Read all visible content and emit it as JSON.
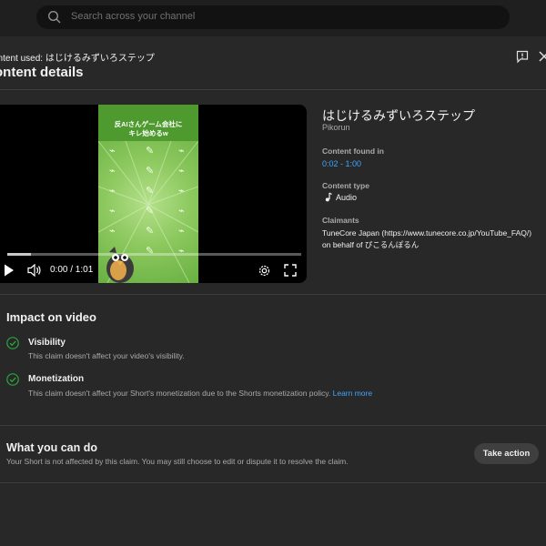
{
  "search": {
    "placeholder": "Search across your channel"
  },
  "dialog": {
    "content_used": "ontent used: はじけるみずいろステップ",
    "title": "ontent details"
  },
  "thumbnail": {
    "line1": "反AIさんゲーム会社に",
    "line2": "キレ始めるw"
  },
  "player": {
    "time": "0:00 / 1:01",
    "progress": 0.08
  },
  "details": {
    "song_title": "はじけるみずいろステップ",
    "artist": "Pikorun",
    "content_found_label": "Content found in",
    "content_found_value": "0:02 - 1:00",
    "content_type_label": "Content type",
    "content_type_value": "Audio",
    "claimants_label": "Claimants",
    "claimant_line1": "TuneCore Japan (https://www.tunecore.co.jp/YouTube_FAQ/)",
    "claimant_line2": "on behalf of ぴこるんぽるん"
  },
  "impact": {
    "title": "Impact on video",
    "visibility_title": "Visibility",
    "visibility_desc": "This claim doesn't affect your video's visibility.",
    "monetization_title": "Monetization",
    "monetization_desc": "This claim doesn't affect your Short's monetization due to the Shorts monetization policy.",
    "learn_more": "Learn more"
  },
  "actions": {
    "title": "What you can do",
    "desc": "Your Short is not affected by this claim. You may still choose to edit or dispute it to resolve the claim.",
    "take_action": "Take action"
  },
  "colors": {
    "accent": "#3ea6ff",
    "check": "#2ba640",
    "background": "#282828"
  }
}
